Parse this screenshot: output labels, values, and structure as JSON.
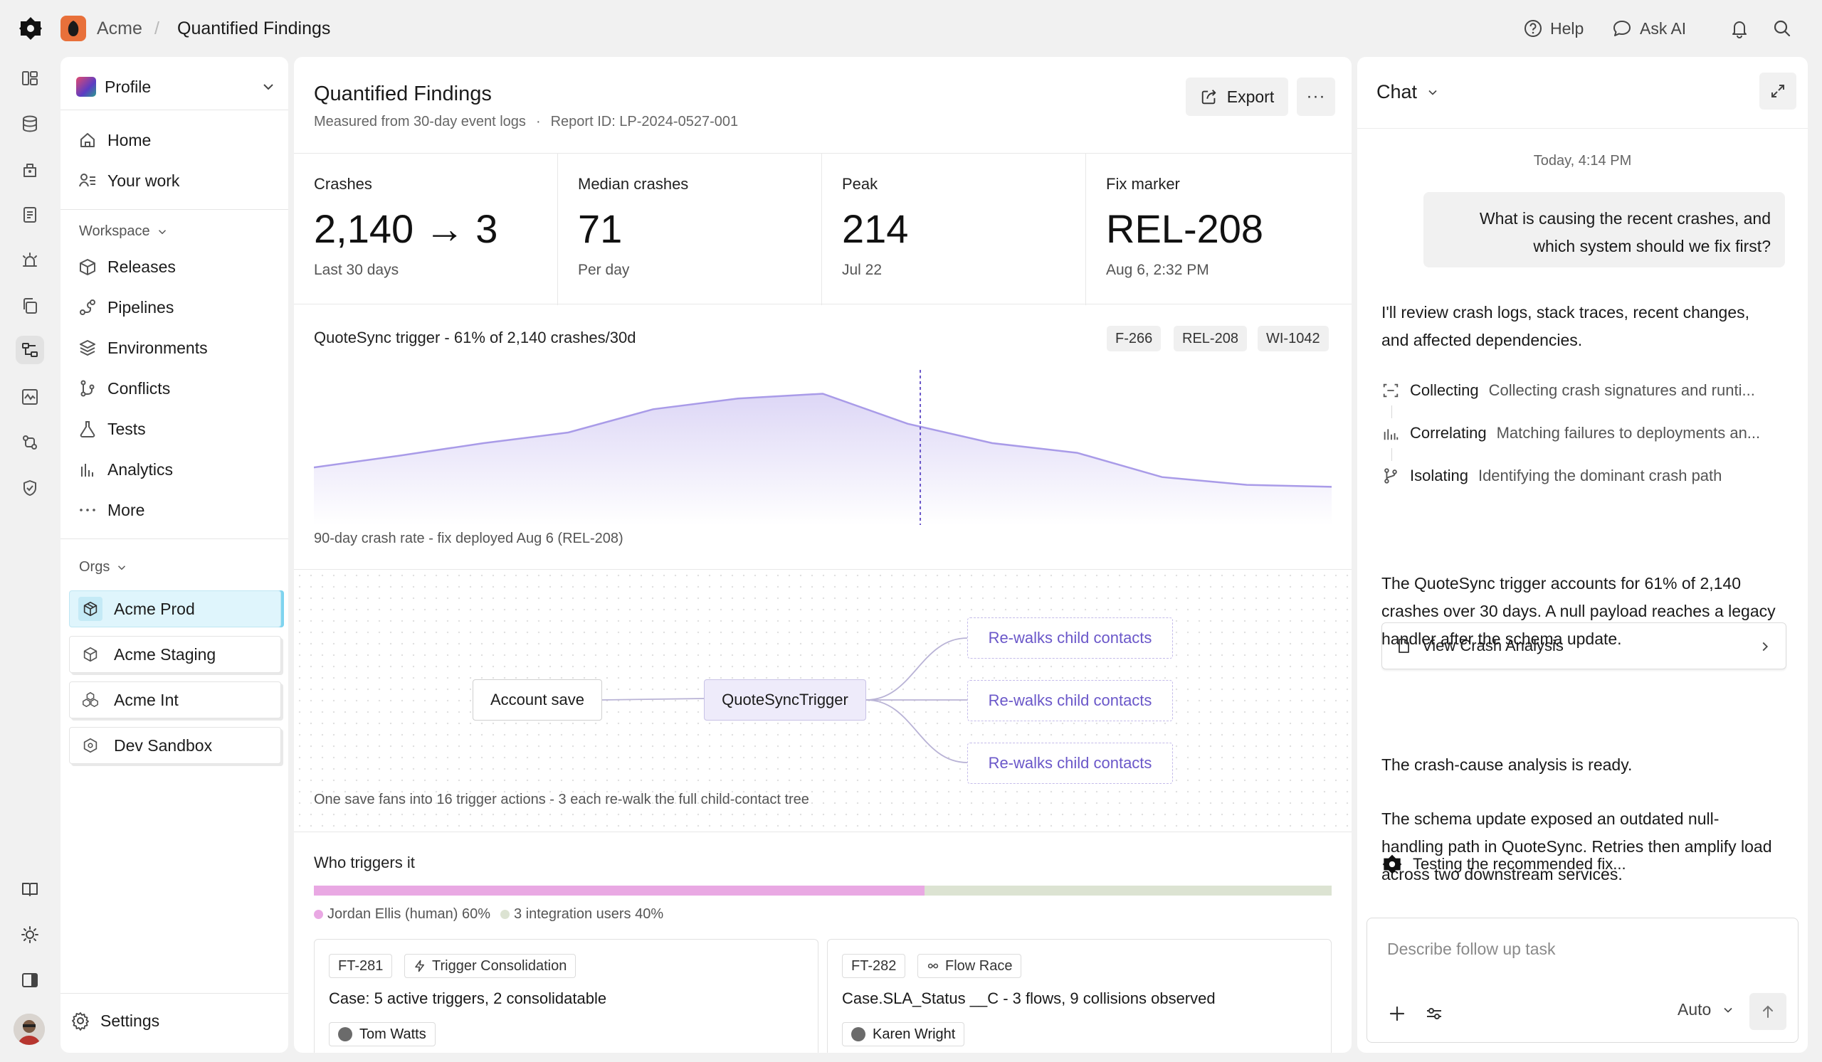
{
  "topbar": {
    "org": "Acme",
    "separator": "/",
    "page": "Quantified Findings",
    "help": "Help",
    "ask_ai": "Ask AI"
  },
  "sidebar": {
    "profile": "Profile",
    "nav": [
      "Home",
      "Your work"
    ],
    "workspace_label": "Workspace",
    "workspace": [
      "Releases",
      "Pipelines",
      "Environments",
      "Conflicts",
      "Tests",
      "Analytics",
      "More"
    ],
    "orgs_label": "Orgs",
    "orgs": [
      "Acme Prod",
      "Acme Staging",
      "Acme Int",
      "Dev Sandbox"
    ],
    "settings": "Settings"
  },
  "main": {
    "title": "Quantified Findings",
    "subtitle": "Measured from 30-day event logs",
    "bullet": "·",
    "report_id": "Report ID: LP-2024-0527-001",
    "export": "Export",
    "more": "···",
    "stats": [
      {
        "label": "Crashes",
        "value": "2,140 → 3",
        "caption": "Last 30 days"
      },
      {
        "label": "Median crashes",
        "value": "71",
        "caption": "Per day"
      },
      {
        "label": "Peak",
        "value": "214",
        "caption": "Jul 22"
      },
      {
        "label": "Fix marker",
        "value": "REL-208",
        "caption": "Aug 6, 2:32 PM"
      }
    ],
    "chart": {
      "title": "QuoteSync trigger - 61% of 2,140 crashes/30d",
      "tags": [
        "F-266",
        "REL-208",
        "WI-1042"
      ],
      "caption": "90-day crash rate - fix deployed Aug 6 (REL-208)"
    },
    "flow": {
      "source": "Account save",
      "trigger": "QuoteSyncTrigger",
      "targets": [
        "Re-walks child contacts",
        "Re-walks child contacts",
        "Re-walks child contacts"
      ],
      "caption": "One save fans into 16 trigger actions - 3 each re-walk the full child-contact tree"
    },
    "who": {
      "title": "Who triggers it",
      "segments": [
        {
          "label": "Jordan Ellis (human) 60%",
          "share": 0.6,
          "color": "#e9a8e3"
        },
        {
          "label": "3 integration users 40%",
          "share": 0.4,
          "color": "#dce3d2"
        }
      ]
    },
    "cards": [
      {
        "id": "FT-281",
        "kind": "Trigger Consolidation",
        "text": "Case: 5 active triggers, 2 consolidatable",
        "person": "Tom Watts"
      },
      {
        "id": "FT-282",
        "kind": "Flow Race",
        "text": "Case.SLA_Status __C - 3 flows, 9 collisions observed",
        "person": "Karen Wright"
      }
    ]
  },
  "chart_data": {
    "type": "area",
    "title": "QuoteSync trigger - 61% of 2,140 crashes/30d",
    "xlabel": "",
    "ylabel": "",
    "y": [
      30,
      42,
      55,
      66,
      90,
      101,
      106,
      75,
      55,
      45,
      20,
      12,
      10
    ],
    "marker": {
      "label": "REL-208",
      "x_index": 7.15
    },
    "grid": false
  },
  "chat": {
    "title": "Chat",
    "time": "Today, 4:14 PM",
    "question": "What is causing the recent crashes, and which system should we fix first?",
    "intro": "I'll review crash logs, stack traces, recent changes, and affected dependencies.",
    "steps": [
      {
        "label": "Collecting",
        "detail": "Collecting crash signatures and runti..."
      },
      {
        "label": "Correlating",
        "detail": "Matching failures to deployments an..."
      },
      {
        "label": "Isolating",
        "detail": "Identifying the dominant crash path"
      }
    ],
    "finding": "The QuoteSync trigger accounts for 61% of 2,140 crashes over 30 days. A null payload reaches a legacy handler after the schema update.",
    "view_link": "View Crash Analysis",
    "ready": "The crash-cause analysis is ready.",
    "explanation": "The schema update exposed an outdated null-handling path in QuoteSync. Retries then amplify load across two downstream services.",
    "testing": "Testing the recommended fix...",
    "placeholder": "Describe follow up task",
    "mode": "Auto"
  }
}
